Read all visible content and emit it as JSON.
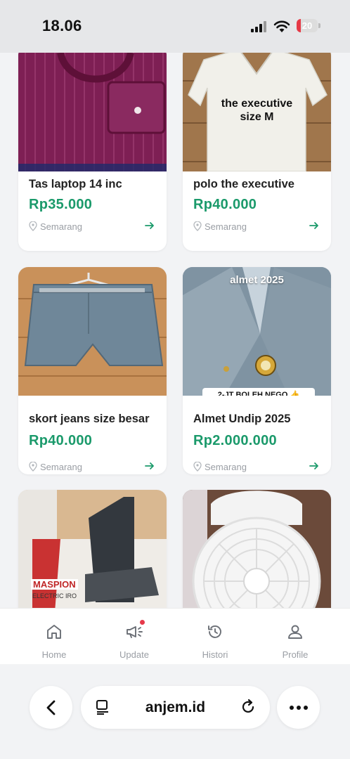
{
  "status": {
    "time": "18.06",
    "battery": "20",
    "battery_level": 0.2
  },
  "listings": [
    {
      "title": "Tas laptop 14 inc",
      "price": "Rp35.000",
      "location": "Semarang",
      "image": "quilted magenta laptop bag"
    },
    {
      "title": "polo the executive",
      "price": "Rp40.000",
      "location": "Semarang",
      "image": "white polo shirt",
      "overlay": "the executive\nsize M"
    },
    {
      "title": "skort jeans size besar",
      "price": "Rp40.000",
      "location": "Semarang",
      "image": "denim skort on hanger"
    },
    {
      "title": "Almet Undip 2025",
      "price": "Rp2.000.000",
      "location": "Semarang",
      "image": "blue-grey university jacket",
      "overlay_top": "almet 2025",
      "overlay_banner": "2-JT BOLEH NEGO 👍"
    },
    {
      "image": "electric iron in box",
      "box_label": "MASPION",
      "box_sub": "ELECTRIC IRO"
    },
    {
      "image": "white desk fan"
    }
  ],
  "nav": {
    "items": [
      "Home",
      "Update",
      "Histori",
      "Profile"
    ]
  },
  "browser": {
    "url": "anjem.id"
  },
  "colors": {
    "price": "#1b9a6b",
    "badge": "#e6394a"
  }
}
